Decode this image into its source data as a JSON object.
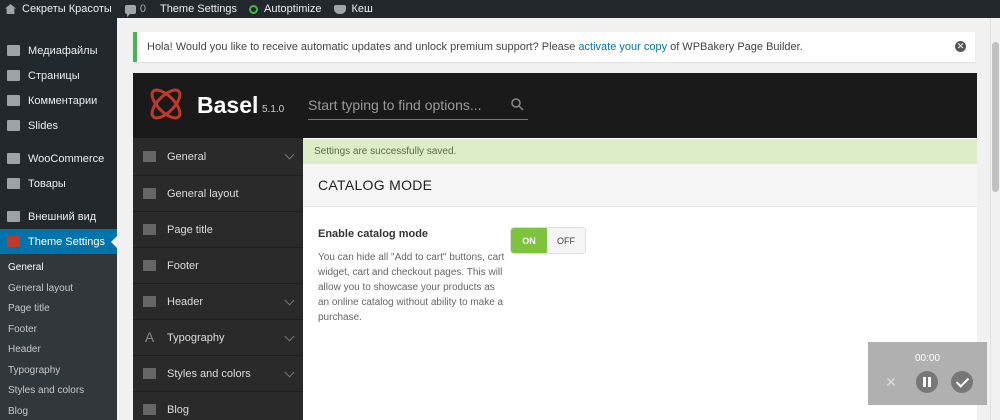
{
  "adminbar": {
    "site_name": "Секреты Красоты",
    "comments_count": "0",
    "theme_settings": "Theme Settings",
    "autoptimize": "Autoptimize",
    "cache": "Кеш"
  },
  "sidebar": {
    "items": [
      {
        "label": "Медиафайлы",
        "icon": "media-icon"
      },
      {
        "label": "Страницы",
        "icon": "pages-icon"
      },
      {
        "label": "Комментарии",
        "icon": "comments-icon"
      },
      {
        "label": "Slides",
        "icon": "slides-icon"
      },
      {
        "label": "WooCommerce",
        "icon": "woocommerce-icon"
      },
      {
        "label": "Товары",
        "icon": "products-icon"
      },
      {
        "label": "Внешний вид",
        "icon": "appearance-icon"
      },
      {
        "label": "Theme Settings",
        "icon": "basel-icon",
        "active": true
      }
    ],
    "submenu": [
      "General",
      "General layout",
      "Page title",
      "Footer",
      "Header",
      "Typography",
      "Styles and colors",
      "Blog"
    ]
  },
  "notice": {
    "before": "Hola! Would you like to receive automatic updates and unlock premium support? Please",
    "link": "activate your copy",
    "after": "of WPBakery Page Builder."
  },
  "panel": {
    "brand": "Basel",
    "version": "5.1.0",
    "search_placeholder": "Start typing to find options...",
    "nav": [
      {
        "label": "General",
        "icon": "home-icon",
        "has_children": true
      },
      {
        "label": "General layout",
        "icon": "layout-icon",
        "has_children": false
      },
      {
        "label": "Page title",
        "icon": "page-title-icon",
        "has_children": false
      },
      {
        "label": "Footer",
        "icon": "footer-icon",
        "has_children": false
      },
      {
        "label": "Header",
        "icon": "header-icon",
        "has_children": true
      },
      {
        "label": "Typography",
        "icon": "typography-icon",
        "has_children": true
      },
      {
        "label": "Styles and colors",
        "icon": "brush-icon",
        "has_children": true
      },
      {
        "label": "Blog",
        "icon": "blog-icon",
        "has_children": false
      }
    ],
    "success_message": "Settings are successfully saved.",
    "section_title": "CATALOG MODE",
    "field": {
      "label": "Enable catalog mode",
      "description": "You can hide all \"Add to cart\" buttons, cart widget, cart and checkout pages. This will allow you to showcase your products as an online catalog without ability to make a purchase.",
      "on_label": "ON",
      "off_label": "OFF",
      "value": "on"
    }
  },
  "recorder": {
    "time": "00:00"
  },
  "colors": {
    "accent": "#0073aa",
    "success_bg": "#dcedc8",
    "toggle_on": "#7dc33e",
    "dark": "#1a1a1a"
  }
}
